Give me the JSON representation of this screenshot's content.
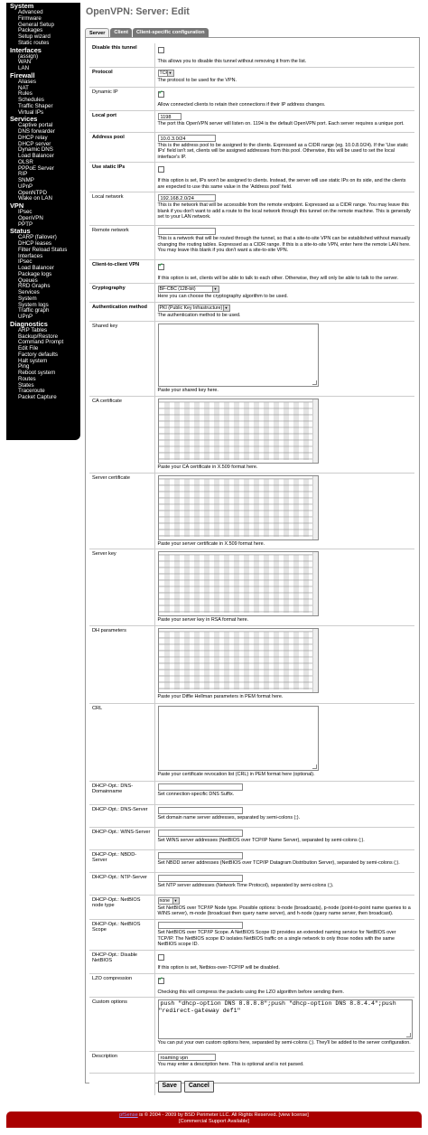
{
  "sidebar": {
    "sections": [
      {
        "name": "System",
        "items": [
          "Advanced",
          "Firmware",
          "General Setup",
          "Packages",
          "Setup wizard",
          "Static routes"
        ]
      },
      {
        "name": "Interfaces",
        "items": [
          "(assign)",
          "WAN",
          "LAN"
        ]
      },
      {
        "name": "Firewall",
        "items": [
          "Aliases",
          "NAT",
          "Rules",
          "Schedules",
          "Traffic Shaper",
          "Virtual IPs"
        ]
      },
      {
        "name": "Services",
        "items": [
          "Captive portal",
          "DNS forwarder",
          "DHCP relay",
          "DHCP server",
          "Dynamic DNS",
          "Load Balancer",
          "OLSR",
          "PPPoE Server",
          "RIP",
          "SNMP",
          "UPnP",
          "OpenNTPD",
          "Wake on LAN"
        ]
      },
      {
        "name": "VPN",
        "items": [
          "IPsec",
          "OpenVPN",
          "PPTP"
        ]
      },
      {
        "name": "Status",
        "items": [
          "CARP (failover)",
          "DHCP leases",
          "Filter Reload Status",
          "Interfaces",
          "IPsec",
          "Load Balancer",
          "Package logs",
          "Queues",
          "RRD Graphs",
          "Services",
          "System",
          "System logs",
          "Traffic graph",
          "UPnP"
        ]
      },
      {
        "name": "Diagnostics",
        "items": [
          "ARP Tables",
          "Backup/Restore",
          "Command Prompt",
          "Edit File",
          "Factory defaults",
          "Halt system",
          "Ping",
          "Reboot system",
          "Routes",
          "States",
          "Traceroute",
          "Packet Capture"
        ]
      }
    ]
  },
  "page": {
    "title": "OpenVPN: Server: Edit",
    "tabs": [
      "Server",
      "Client",
      "Client-specific configuration"
    ]
  },
  "form": {
    "disable": {
      "label": "Disable this tunnel",
      "checked": false,
      "hint": "This allows you to disable this tunnel without removing it from the list."
    },
    "protocol": {
      "label": "Protocol",
      "value": "TCP",
      "hint": "The protocol to be used for the VPN."
    },
    "dynamic_ip": {
      "label": "Dynamic IP",
      "checked": true,
      "hint": "Allow connected clients to retain their connections if their IP address changes."
    },
    "local_port": {
      "label": "Local port",
      "value": "1198",
      "hint": "The port this OpenVPN server will listen on. 1194 is the default OpenVPN port. Each server requires a unique port."
    },
    "address_pool": {
      "label": "Address pool",
      "value": "10.0.3.0/24",
      "hint": "This is the address pool to be assigned to the clients. Expressed as a CIDR range (eg. 10.0.8.0/24). If the 'Use static IPs' field isn't set, clients will be assigned addresses from this pool. Otherwise, this will be used to set the local interface's IP."
    },
    "static_ips": {
      "label": "Use static IPs",
      "checked": false,
      "hint": "If this option is set, IPs won't be assigned to clients. Instead, the server will use static IPs on its side, and the clients are expected to use this same value in the 'Address pool' field."
    },
    "local_network": {
      "label": "Local network",
      "value": "192.168.2.0/24",
      "hint": "This is the network that will be accessible from the remote endpoint. Expressed as a CIDR range. You may leave this blank if you don't want to add a route to the local network through this tunnel on the remote machine. This is generally set to your LAN network."
    },
    "remote_network": {
      "label": "Remote network",
      "value": "",
      "hint": "This is a network that will be routed through the tunnel, so that a site-to-site VPN can be established without manually changing the routing tables. Expressed as a CIDR range. If this is a site-to-site VPN, enter here the remote LAN here. You may leave this blank if you don't want a site-to-site VPN."
    },
    "c2c": {
      "label": "Client-to-client VPN",
      "checked": true,
      "hint": "If this option is set, clients will be able to talk to each other. Otherwise, they will only be able to talk to the server."
    },
    "crypto": {
      "label": "Cryptography",
      "value": "BF-CBC (128-bit)",
      "hint": "Here you can choose the cryptography algorithm to be used."
    },
    "auth": {
      "label": "Authentication method",
      "value": "PKI (Public Key Infrastructure)",
      "hint": "The authentication method to be used."
    },
    "shared_key": {
      "label": "Shared key",
      "hint": "Paste your shared key here."
    },
    "ca_cert": {
      "label": "CA certificate",
      "hint": "Paste your CA certificate in X.509 format here."
    },
    "server_cert": {
      "label": "Server certificate",
      "hint": "Paste your server certificate in X.509 format here."
    },
    "server_key": {
      "label": "Server key",
      "hint": "Paste your server key in RSA format here."
    },
    "dh": {
      "label": "DH parameters",
      "hint": "Paste your Diffie Hellman parameters in PEM format here."
    },
    "crl": {
      "label": "CRL",
      "hint": "Paste your certificate revocation list (CRL) in PEM format here (optional)."
    },
    "dhcp_domain": {
      "label": "DHCP-Opt.: DNS-Domainname",
      "value": "",
      "hint": "Set connection-specific DNS Suffix."
    },
    "dhcp_dns": {
      "label": "DHCP-Opt.: DNS-Server",
      "value": "",
      "hint": "Set domain name server addresses, separated by semi-colons (;)."
    },
    "dhcp_wins": {
      "label": "DHCP-Opt.: WINS-Server",
      "value": "",
      "hint": "Set WINS server addresses (NetBIOS over TCP/IP Name Server), separated by semi-colons (;)."
    },
    "dhcp_nbdd": {
      "label": "DHCP-Opt.: NBDD-Server",
      "value": "",
      "hint": "Set NBDD server addresses (NetBIOS over TCP/IP Datagram Distribution Server), separated by semi-colons (;)."
    },
    "dhcp_ntp": {
      "label": "DHCP-Opt.: NTP-Server",
      "value": "",
      "hint": "Set NTP server addresses (Network Time Protocol), separated by semi-colons (;)."
    },
    "netbios_type": {
      "label": "DHCP-Opt.: NetBIOS node type",
      "value": "none",
      "hint": "Set NetBIOS over TCP/IP Node type. Possible options: b-node (broadcasts), p-node (point-to-point name queries to a WINS server), m-node (broadcast then query name server), and h-node (query name server, then broadcast)."
    },
    "netbios_scope": {
      "label": "DHCP-Opt.: NetBIOS Scope",
      "value": "",
      "hint": "Set NetBIOS over TCP/IP Scope. A NetBIOS Scope ID provides an extended naming service for NetBIOS over TCP/IP. The NetBIOS scope ID isolates NetBIOS traffic on a single network to only those nodes with the same NetBIOS scope ID."
    },
    "netbios_disable": {
      "label": "DHCP-Opt.: Disable NetBIOS",
      "checked": false,
      "hint": "If this option is set, Netbios-over-TCP/IP will be disabled."
    },
    "lzo": {
      "label": "LZO compression",
      "checked": true,
      "hint": "Checking this will compress the packets using the LZO algorithm before sending them."
    },
    "custom": {
      "label": "Custom options",
      "value": "push \"dhcp-option DNS 8.8.8.8\";push \"dhcp-option DNS 8.8.4.4\";push\n\"redirect-gateway def1\"",
      "hint": "You can put your own custom options here, separated by semi-colons (;). They'll be added to the server configuration."
    },
    "description": {
      "label": "Description",
      "value": "roaming vpn",
      "hint": "You may enter a description here. This is optional and is not parsed."
    },
    "save_label": "Save",
    "cancel_label": "Cancel"
  },
  "footer": {
    "brand": "pfSense",
    "line1": " is © 2004 - 2009 by BSD Perimeter LLC. All Rights Reserved. [view license]",
    "line2": "[Commercial Support Available]"
  }
}
